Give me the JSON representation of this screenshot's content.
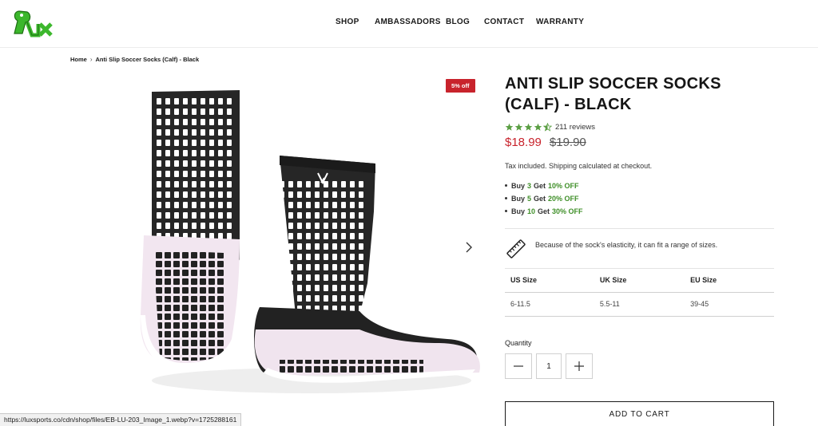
{
  "header": {
    "nav": [
      {
        "label": "SHOP"
      },
      {
        "label": "AMBASSADORS"
      },
      {
        "label": "BLOG"
      },
      {
        "label": "CONTACT"
      },
      {
        "label": "WARRANTY"
      }
    ]
  },
  "breadcrumb": {
    "home": "Home",
    "current": "Anti Slip Soccer Socks (Calf) - Black"
  },
  "gallery": {
    "badge": "5% off"
  },
  "product": {
    "title": "Anti Slip Soccer Socks (Calf) - Black",
    "rating": 4.5,
    "reviews": "211 reviews",
    "price_sale": "$18.99",
    "price_old": "$19.90",
    "tax_note": "Tax included. Shipping calculated at checkout.",
    "offers": [
      {
        "prefix": "Buy",
        "qty": "3",
        "mid": "Get",
        "discount": "10% OFF"
      },
      {
        "prefix": "Buy",
        "qty": "5",
        "mid": "Get",
        "discount": "20% OFF"
      },
      {
        "prefix": "Buy",
        "qty": "10",
        "mid": "Get",
        "discount": "30% OFF"
      }
    ],
    "fit_note": "Because of the sock's elasticity, it can fit a range of sizes.",
    "size_table": {
      "headers": [
        "US Size",
        "UK Size",
        "EU Size"
      ],
      "row": [
        "6-11.5",
        "5.5-11",
        "39-45"
      ]
    },
    "quantity_label": "Quantity",
    "quantity_value": "1",
    "add_to_cart": "ADD TO CART"
  },
  "status_bar": {
    "url": "https://luxsports.co/cdn/shop/files/EB-LU-203_Image_1.webp?v=1725288161"
  },
  "colors": {
    "sale": "#c8232c",
    "offer_green": "#3f8f28",
    "star": "#5a9e43",
    "logo_green": "#3cb72c"
  }
}
